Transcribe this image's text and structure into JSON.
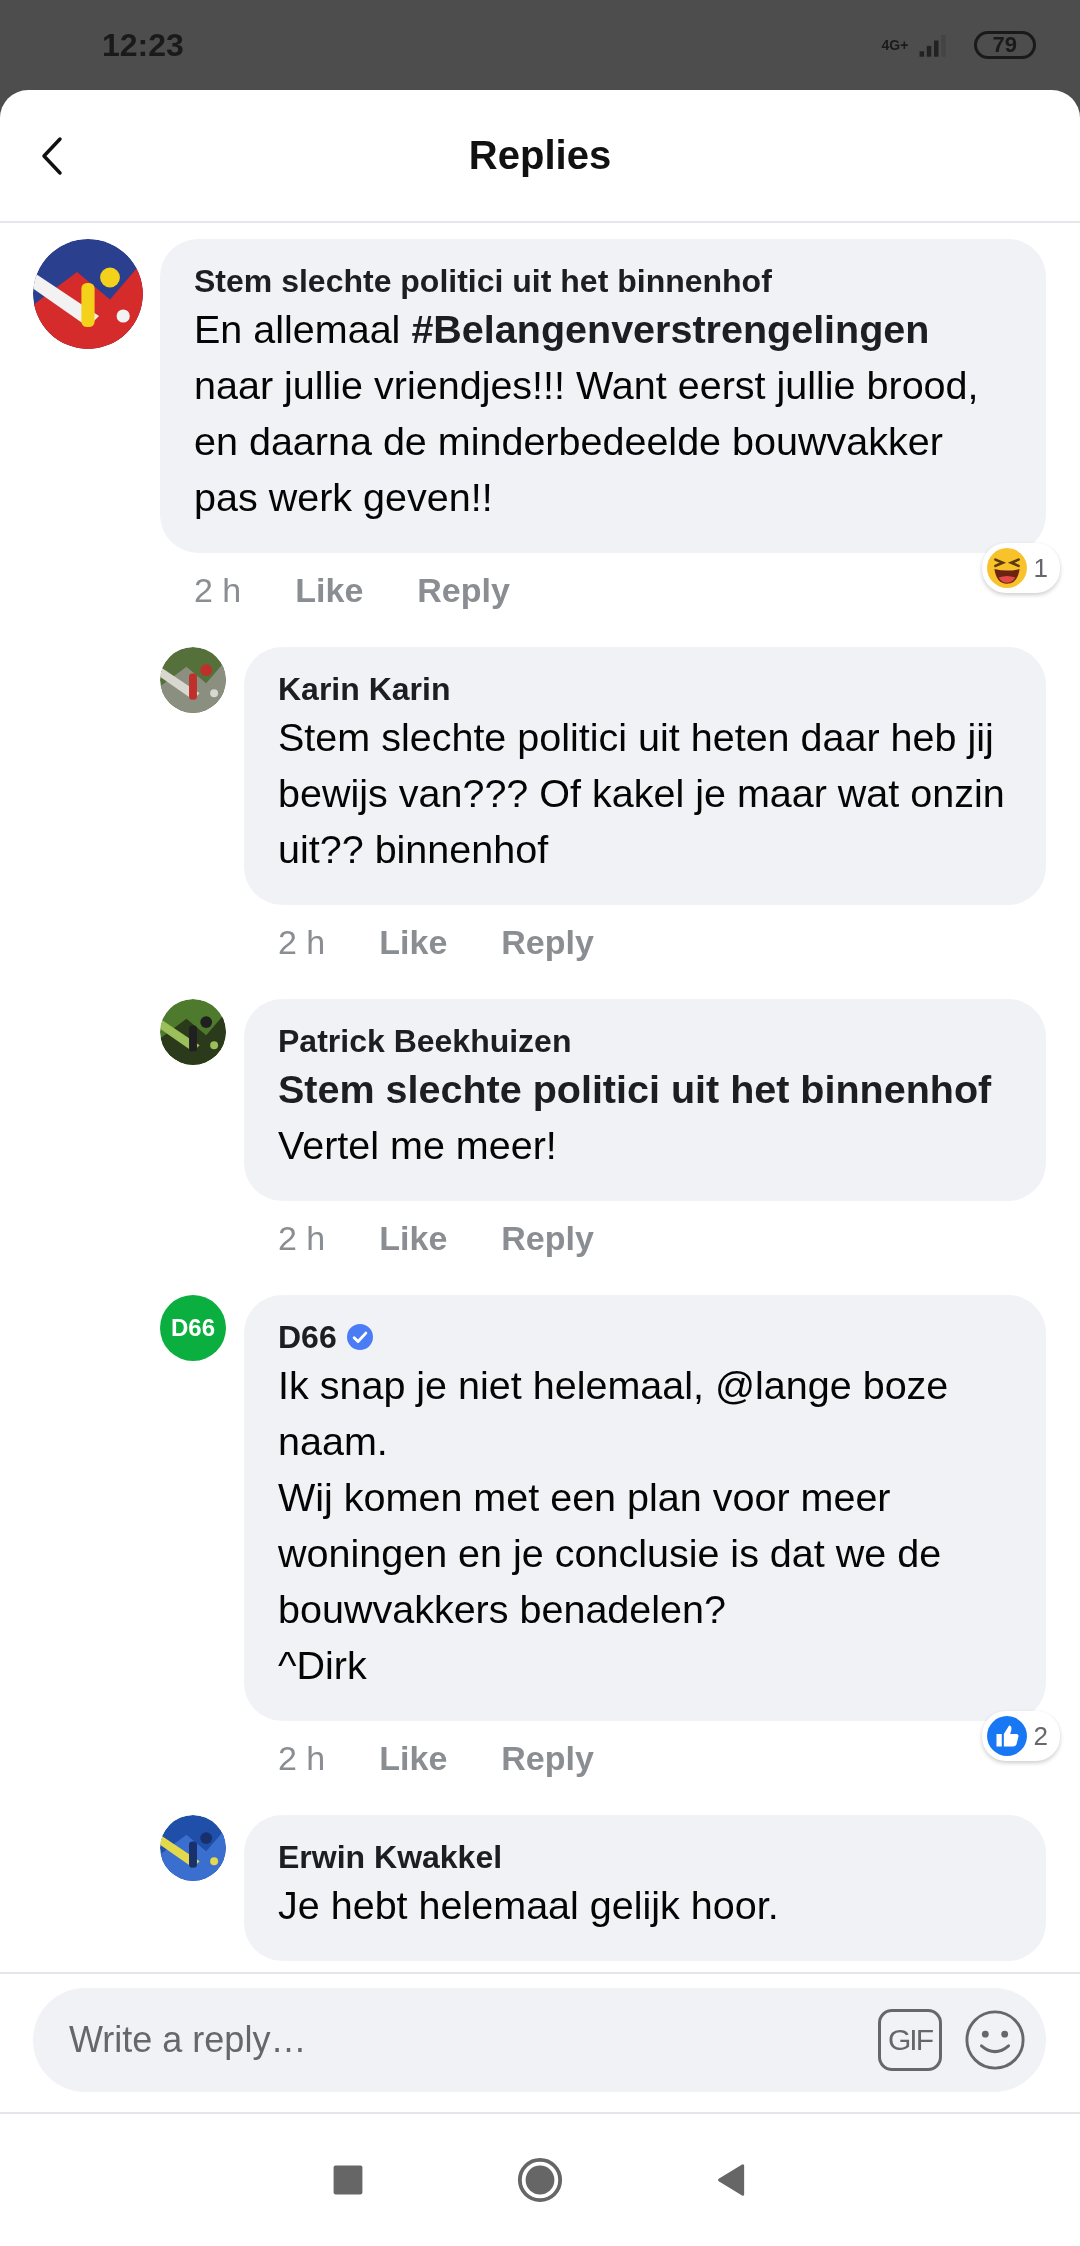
{
  "status_bar": {
    "time": "12:23",
    "network": "4G+",
    "battery": "79"
  },
  "header": {
    "title": "Replies"
  },
  "comments": [
    {
      "author": "Stem slechte politici uit het binnenhof",
      "verified": false,
      "text": "En allemaal **#Belangenverstrengelingen** naar jullie vriendjes!!! Want eerst jullie brood, en daarna de minderbedeelde bouwvakker pas werk geven!!",
      "time": "2 h",
      "actions": [
        "Like",
        "Reply"
      ],
      "reaction": {
        "kind": "haha",
        "count": "1"
      },
      "replies": [
        {
          "author": "Karin Karin",
          "verified": false,
          "text": "Stem slechte politici uit heten daar heb jij bewijs van??? Of kakel je maar wat onzin uit?? binnenhof",
          "time": "2 h",
          "actions": [
            "Like",
            "Reply"
          ]
        },
        {
          "author": "Patrick Beekhuizen",
          "verified": false,
          "text": "**Stem slechte politici uit het binnenhof** Vertel me meer!",
          "time": "2 h",
          "actions": [
            "Like",
            "Reply"
          ]
        },
        {
          "author": "D66",
          "verified": true,
          "avatar": {
            "kind": "logo",
            "text": "D66",
            "color": "#0aaf3f"
          },
          "text": "Ik snap je niet helemaal, @lange boze naam.\nWij komen met een plan voor meer woningen en je conclusie is dat we de bouwvakkers benadelen?\n^Dirk",
          "time": "2 h",
          "actions": [
            "Like",
            "Reply"
          ],
          "reaction": {
            "kind": "like",
            "count": "2"
          }
        },
        {
          "author": "Erwin Kwakkel",
          "verified": false,
          "text": "Je hebt helemaal gelijk hoor."
        }
      ]
    }
  ],
  "composer": {
    "placeholder": "Write a reply…",
    "gif_label": "GIF"
  }
}
